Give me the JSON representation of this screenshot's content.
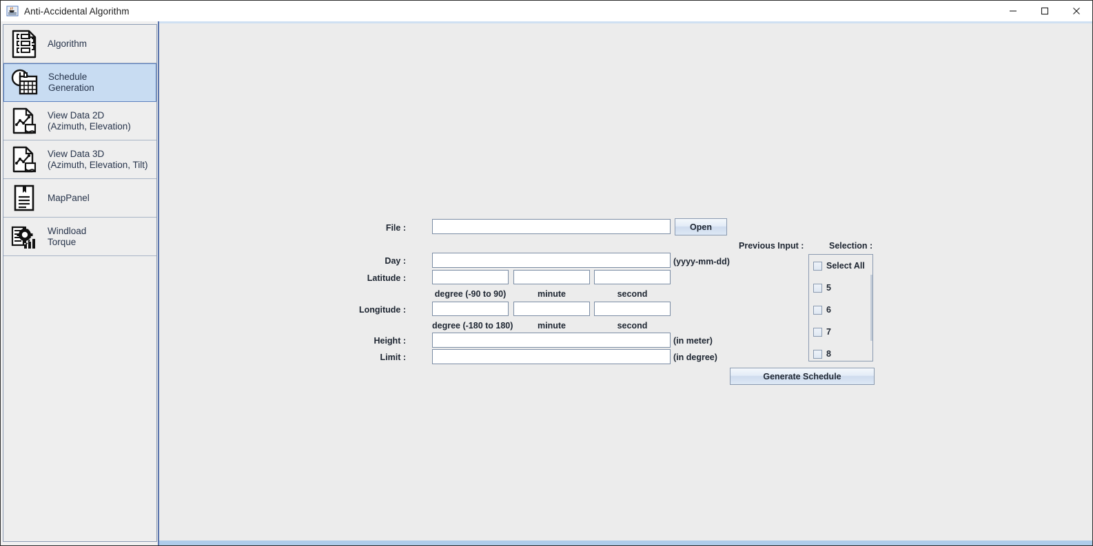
{
  "window": {
    "title": "Anti-Accidental Algorithm",
    "app_icon": "java-coffee-cup-icon",
    "minimize_label": "—",
    "maximize_label": "□",
    "close_label": "✕"
  },
  "sidebar": {
    "items": [
      {
        "label": "Algorithm",
        "icon": "algorithm-flowchart-document-icon",
        "selected": false
      },
      {
        "label": "Schedule\nGeneration",
        "icon": "clock-calendar-icon",
        "selected": true
      },
      {
        "label": "View Data 2D\n(Azimuth, Elevation)",
        "icon": "chart-document-icon",
        "selected": false
      },
      {
        "label": "View Data 3D\n(Azimuth, Elevation, Tilt)",
        "icon": "chart-document-icon",
        "selected": false
      },
      {
        "label": "MapPanel",
        "icon": "bookmark-document-icon",
        "selected": false
      },
      {
        "label": "Windload\nTorque",
        "icon": "gear-documents-bar-chart-icon",
        "selected": false
      }
    ]
  },
  "form": {
    "file": {
      "label": "File :",
      "value": "",
      "placeholder": ""
    },
    "open_button": "Open",
    "day": {
      "label": "Day :",
      "value": "",
      "placeholder": "",
      "hint": "(yyyy-mm-dd)"
    },
    "latitude": {
      "label": "Latitude :",
      "degree": "",
      "minute": "",
      "second": "",
      "degree_hint": "degree (-90 to 90)",
      "minute_hint": "minute",
      "second_hint": "second"
    },
    "longitude": {
      "label": "Longitude :",
      "degree": "",
      "minute": "",
      "second": "",
      "degree_hint": "degree (-180 to 180)",
      "minute_hint": "minute",
      "second_hint": "second"
    },
    "height": {
      "label": "Height :",
      "value": "",
      "hint": "(in meter)"
    },
    "limit": {
      "label": "Limit :",
      "value": "",
      "hint": "(in degree)"
    }
  },
  "right_panel": {
    "previous_input_label": "Previous Input :",
    "selection_label": "Selection :",
    "selection_items": [
      {
        "label": "Select All",
        "checked": false
      },
      {
        "label": "5",
        "checked": false
      },
      {
        "label": "6",
        "checked": false
      },
      {
        "label": "7",
        "checked": false
      },
      {
        "label": "8",
        "checked": false
      }
    ],
    "generate_button": "Generate Schedule"
  },
  "colors": {
    "selected_item_bg": "#c8dcf2",
    "selected_item_border": "#5a7fbe",
    "panel_border": "#5b75ad",
    "panel_bg": "#ececec",
    "label_text": "#1c2430"
  }
}
